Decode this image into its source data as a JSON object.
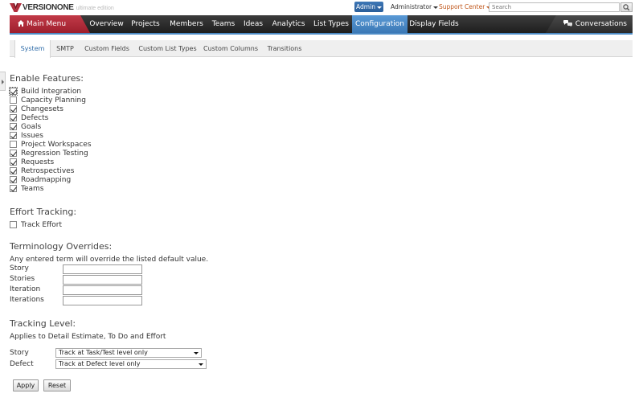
{
  "app": {
    "brand": "VERSIONONE",
    "edition": "ultimate edition"
  },
  "topbar": {
    "admin_label": "Admin",
    "user_label": "Administrator",
    "support_label": "Support Center",
    "search_placeholder": "Search"
  },
  "nav": {
    "main_menu": "Main Menu",
    "tabs": [
      "Overview",
      "Projects",
      "Members",
      "Teams",
      "Ideas",
      "Analytics",
      "List Types",
      "Configuration",
      "Display Fields"
    ],
    "active_tab": "Configuration",
    "conversations": "Conversations"
  },
  "subtabs": {
    "items": [
      "System",
      "SMTP",
      "Custom Fields",
      "Custom List Types",
      "Custom Columns",
      "Transitions"
    ],
    "active": "System"
  },
  "features": {
    "heading": "Enable Features:",
    "items": [
      {
        "label": "Build Integration",
        "checked": true
      },
      {
        "label": "Capacity Planning",
        "checked": false
      },
      {
        "label": "Changesets",
        "checked": true
      },
      {
        "label": "Defects",
        "checked": true
      },
      {
        "label": "Goals",
        "checked": true
      },
      {
        "label": "Issues",
        "checked": true
      },
      {
        "label": "Project Workspaces",
        "checked": false
      },
      {
        "label": "Regression Testing",
        "checked": true
      },
      {
        "label": "Requests",
        "checked": true
      },
      {
        "label": "Retrospectives",
        "checked": true
      },
      {
        "label": "Roadmapping",
        "checked": true
      },
      {
        "label": "Teams",
        "checked": true
      }
    ]
  },
  "effort": {
    "heading": "Effort Tracking:",
    "track_effort_label": "Track Effort",
    "track_effort_checked": false
  },
  "terminology": {
    "heading": "Terminology Overrides:",
    "description": "Any entered term will override the listed default value.",
    "rows": [
      {
        "label": "Story",
        "value": ""
      },
      {
        "label": "Stories",
        "value": ""
      },
      {
        "label": "Iteration",
        "value": ""
      },
      {
        "label": "Iterations",
        "value": ""
      }
    ]
  },
  "tracking": {
    "heading": "Tracking Level:",
    "description": "Applies to Detail Estimate, To Do and Effort",
    "story_label": "Story",
    "story_value": "Track at Task/Test level only",
    "defect_label": "Defect",
    "defect_value": "Track at Defect level only"
  },
  "actions": {
    "apply": "Apply",
    "reset": "Reset"
  },
  "colors": {
    "accent_blue": "#3b78b5",
    "main_menu_red": "#b22f3d",
    "nav_dark": "#2a2a2a",
    "support_orange": "#c0561a"
  }
}
